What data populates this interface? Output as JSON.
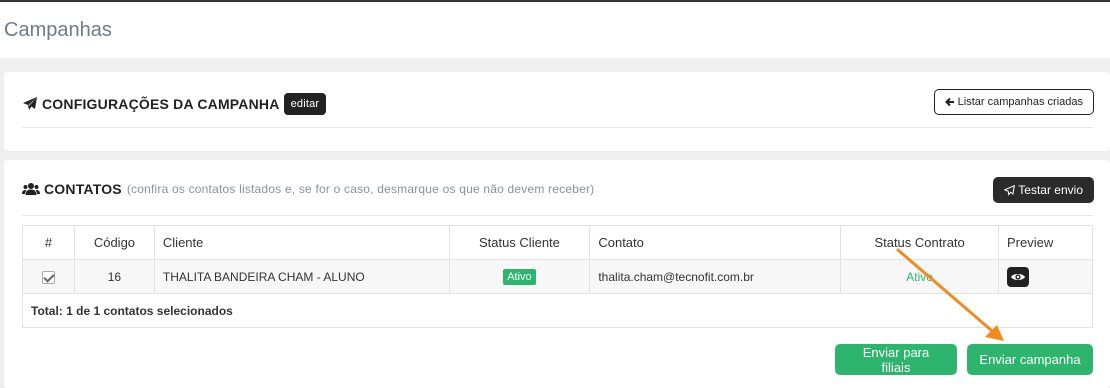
{
  "page": {
    "title": "Campanhas"
  },
  "config_card": {
    "title": "CONFIGURAÇÕES DA CAMPANHA",
    "edit_label": "editar",
    "list_button_label": "Listar campanhas criadas"
  },
  "contacts_card": {
    "title": "CONTATOS",
    "subtitle": "(confira os contatos listados e, se for o caso, desmarque os que não devem receber)",
    "test_button_label": "Testar envio",
    "table": {
      "headers": [
        "#",
        "Código",
        "Cliente",
        "Status Cliente",
        "Contato",
        "Status Contrato",
        "Preview"
      ],
      "rows": [
        {
          "checked": true,
          "codigo": "16",
          "cliente": "THALITA BANDEIRA CHAM - ALUNO",
          "status_cliente": "Ativo",
          "contato": "thalita.cham@tecnofit.com.br",
          "status_contrato": "Ativo"
        }
      ],
      "total": "Total: 1 de 1 contatos selecionados"
    },
    "send_branches_label": "Enviar para filiais",
    "send_campaign_label": "Enviar campanha"
  },
  "colors": {
    "accent_green": "#2db56d",
    "dark": "#222222",
    "annotation_arrow": "#f28a1e"
  },
  "icons": [
    "paper-plane-icon",
    "users-icon",
    "arrow-left-icon",
    "eye-icon"
  ]
}
